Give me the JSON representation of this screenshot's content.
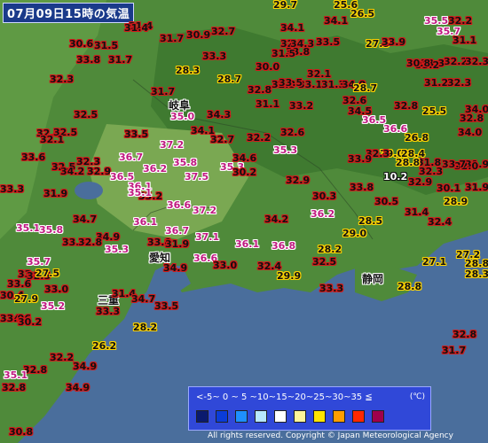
{
  "title": "07月09日15時の気温",
  "cities": [
    {
      "id": "gifu",
      "name": "岐阜"
    },
    {
      "id": "aichi",
      "name": "愛知"
    },
    {
      "id": "mie",
      "name": "三重"
    },
    {
      "id": "shizuoka",
      "name": "静岡"
    }
  ],
  "temperatures": [
    "29.7",
    "25.6",
    "26.5",
    "34.1",
    "31.4",
    "32.2",
    "35.5",
    "35.7",
    "31.4",
    "34.1",
    "30.6",
    "31.5",
    "31.7",
    "30.9",
    "32.7",
    "32.7",
    "33.5",
    "27.5",
    "33.9",
    "31.1",
    "33.8",
    "31.7",
    "33.3",
    "34.3",
    "33.8",
    "31.5",
    "32.2",
    "33.3",
    "33.2",
    "30.8",
    "32.3",
    "32.3",
    "28.3",
    "30.0",
    "32.1",
    "33.1",
    "28.7",
    "32.3",
    "31.3",
    "34.0",
    "31.2",
    "32.3",
    "31.7",
    "32.8",
    "33.5",
    "28.7",
    "32.6",
    "32.8",
    "25.5",
    "32.8",
    "32.5",
    "35.0",
    "31.1",
    "33.2",
    "34.3",
    "34.5",
    "36.5",
    "34.0",
    "32.6",
    "32.5",
    "33.5",
    "34.1",
    "32.7",
    "32.2",
    "32.6",
    "36.6",
    "26.8",
    "34.0",
    "32.1",
    "37.2",
    "35.3",
    "29.0",
    "32.3",
    "28.4",
    "31.8",
    "33.6",
    "36.7",
    "34.6",
    "33.9",
    "28.8",
    "31.9",
    "32.0",
    "32.5",
    "32.3",
    "36.2",
    "35.8",
    "35.3",
    "10.2",
    "32.3",
    "33.7",
    "34.2",
    "32.9",
    "36.5",
    "37.5",
    "30.2",
    "32.9",
    "33.8",
    "32.9",
    "30.1",
    "31.9",
    "33.3",
    "36.1",
    "33.2",
    "30.3",
    "30.5",
    "28.9",
    "31.9",
    "36.6",
    "35.1",
    "37.2",
    "36.2",
    "31.4",
    "34.7",
    "36.1",
    "34.2",
    "28.5",
    "32.4",
    "35.1",
    "35.8",
    "33.8",
    "34.9",
    "36.7",
    "37.1",
    "29.0",
    "35.3",
    "33.0",
    "36.1",
    "36.8",
    "28.2",
    "27.2",
    "35.7",
    "33.2",
    "32.5",
    "27.1",
    "28.8",
    "32.8",
    "31.9",
    "34.9",
    "36.6",
    "33.0",
    "32.4",
    "29.9",
    "28.3",
    "33.6",
    "32.5",
    "27.5",
    "28.8",
    "30.4",
    "33.0",
    "27.9",
    "33.3",
    "34.6",
    "31.4",
    "35.2",
    "34.7",
    "33.5",
    "33.3",
    "33.0",
    "30.2",
    "28.2",
    "32.8",
    "26.2",
    "31.7",
    "32.2",
    "34.9",
    "32.8",
    "34.9",
    "32.8",
    "35.1",
    "30.8"
  ],
  "legend": {
    "range_text": "<-5~ 0 ~ 5 ~10~15~20~25~30~35 ≦",
    "unit": "(℃)",
    "colors": [
      "#0a1a6e",
      "#0a3cd8",
      "#1e90ff",
      "#b7e7ff",
      "#ffffff",
      "#fff59a",
      "#ffe500",
      "#ff9e00",
      "#ff2800",
      "#a0004b"
    ]
  },
  "copyright": "All rights reserved. Copyright © Japan Meteorological Agency"
}
